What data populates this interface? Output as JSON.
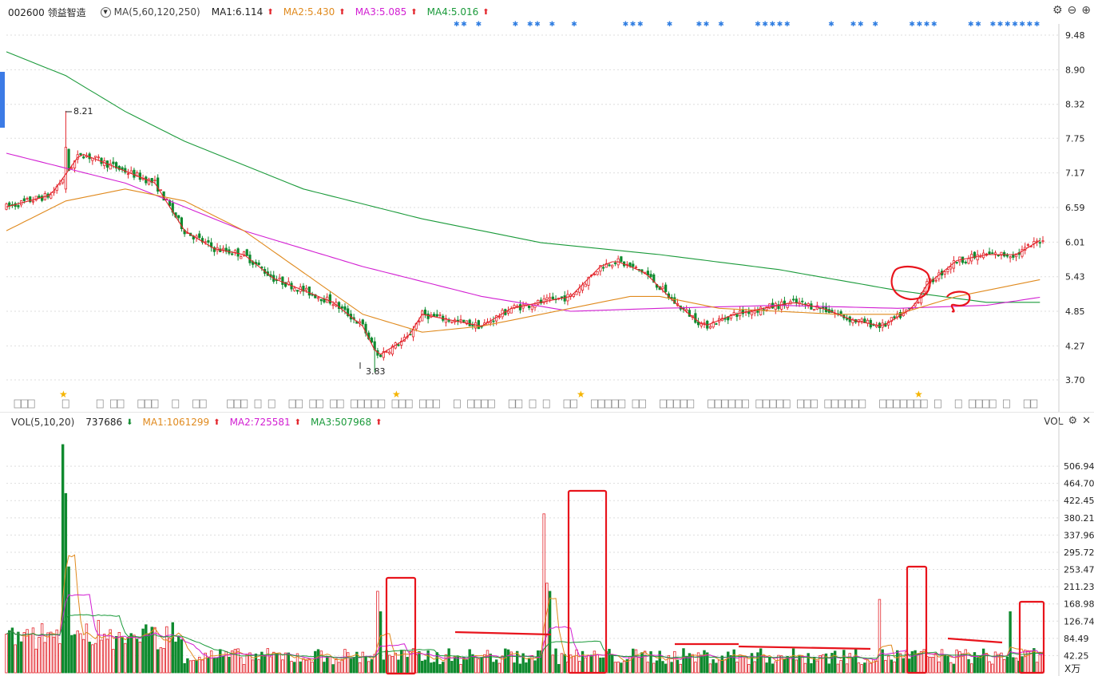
{
  "header": {
    "code_name": "002600 领益智造",
    "ma_setting": "MA(5,60,120,250)",
    "ma1": {
      "label": "MA1:6.114",
      "color": "#222222",
      "dir": "up"
    },
    "ma2": {
      "label": "MA2:5.430",
      "color": "#e08a1e",
      "dir": "up"
    },
    "ma3": {
      "label": "MA3:5.085",
      "color": "#d21ed2",
      "dir": "up"
    },
    "ma4": {
      "label": "MA4:5.016",
      "color": "#1a9a3a",
      "dir": "up"
    }
  },
  "vol_header": {
    "setting": "VOL(5,10,20)",
    "vol": {
      "label": "737686",
      "dir": "down"
    },
    "ma1": {
      "label": "MA1:1061299",
      "color": "#e08a1e",
      "dir": "up"
    },
    "ma2": {
      "label": "MA2:725581",
      "color": "#d21ed2",
      "dir": "up"
    },
    "ma3": {
      "label": "MA3:507968",
      "color": "#1a9a3a",
      "dir": "up"
    },
    "right_label": "VOL"
  },
  "colors": {
    "up": "#e3242b",
    "down": "#0e8a2e",
    "grid": "#dedede",
    "annotation": "#e8141c"
  },
  "chart_data": [
    {
      "type": "candlestick",
      "title": "002600 领益智造",
      "price_ticks": [
        "9.48",
        "8.90",
        "8.32",
        "7.75",
        "7.17",
        "6.59",
        "6.01",
        "5.43",
        "4.85",
        "4.27",
        "3.70"
      ],
      "ylim": [
        3.7,
        9.48
      ],
      "annotations": {
        "high_label": "8.21",
        "low_label": "3.83"
      },
      "ma1_path": [
        [
          0,
          6.6
        ],
        [
          15,
          6.8
        ],
        [
          25,
          7.5
        ],
        [
          30,
          7.4
        ],
        [
          40,
          7.2
        ],
        [
          50,
          7.0
        ],
        [
          60,
          6.2
        ],
        [
          70,
          5.9
        ],
        [
          80,
          5.8
        ],
        [
          90,
          5.4
        ],
        [
          100,
          5.2
        ],
        [
          110,
          5.0
        ],
        [
          120,
          4.6
        ],
        [
          125,
          4.1
        ],
        [
          135,
          4.4
        ],
        [
          140,
          4.8
        ],
        [
          150,
          4.7
        ],
        [
          160,
          4.6
        ],
        [
          170,
          4.9
        ],
        [
          180,
          5.0
        ],
        [
          190,
          5.1
        ],
        [
          200,
          5.6
        ],
        [
          205,
          5.7
        ],
        [
          215,
          5.5
        ],
        [
          225,
          5.0
        ],
        [
          235,
          4.6
        ],
        [
          245,
          4.8
        ],
        [
          255,
          4.9
        ],
        [
          265,
          5.0
        ],
        [
          275,
          4.9
        ],
        [
          285,
          4.7
        ],
        [
          295,
          4.6
        ],
        [
          305,
          4.9
        ],
        [
          310,
          5.3
        ],
        [
          320,
          5.7
        ],
        [
          330,
          5.8
        ],
        [
          340,
          5.8
        ],
        [
          350,
          6.1
        ]
      ],
      "ma2_path": [
        [
          0,
          6.2
        ],
        [
          20,
          6.7
        ],
        [
          40,
          6.9
        ],
        [
          60,
          6.7
        ],
        [
          80,
          6.2
        ],
        [
          100,
          5.5
        ],
        [
          120,
          4.8
        ],
        [
          140,
          4.5
        ],
        [
          160,
          4.6
        ],
        [
          180,
          4.8
        ],
        [
          200,
          5.0
        ],
        [
          210,
          5.1
        ],
        [
          220,
          5.1
        ],
        [
          240,
          4.9
        ],
        [
          260,
          4.85
        ],
        [
          280,
          4.8
        ],
        [
          300,
          4.8
        ],
        [
          320,
          5.1
        ],
        [
          350,
          5.4
        ]
      ],
      "ma3_path": [
        [
          0,
          7.5
        ],
        [
          40,
          7.0
        ],
        [
          80,
          6.2
        ],
        [
          120,
          5.6
        ],
        [
          160,
          5.1
        ],
        [
          190,
          4.85
        ],
        [
          220,
          4.9
        ],
        [
          260,
          4.95
        ],
        [
          300,
          4.9
        ],
        [
          330,
          4.95
        ],
        [
          350,
          5.1
        ]
      ],
      "ma4_path": [
        [
          0,
          9.2
        ],
        [
          20,
          8.8
        ],
        [
          40,
          8.2
        ],
        [
          60,
          7.7
        ],
        [
          80,
          7.3
        ],
        [
          100,
          6.9
        ],
        [
          140,
          6.4
        ],
        [
          180,
          6.0
        ],
        [
          220,
          5.8
        ],
        [
          260,
          5.55
        ],
        [
          300,
          5.2
        ],
        [
          330,
          5.0
        ],
        [
          350,
          5.0
        ]
      ],
      "n_bars": 350
    },
    {
      "type": "bar",
      "title": "VOL(5,10,20)",
      "unit_label": "X万",
      "vol_ticks": [
        "506.94",
        "464.70",
        "422.45",
        "380.21",
        "337.96",
        "295.72",
        "253.47",
        "211.23",
        "168.98",
        "126.74",
        "84.49",
        "42.25"
      ],
      "ylim": [
        0,
        560
      ],
      "spikes": [
        [
          19,
          560
        ],
        [
          20,
          440
        ],
        [
          21,
          260
        ],
        [
          125,
          200
        ],
        [
          126,
          150
        ],
        [
          181,
          390
        ],
        [
          182,
          220
        ],
        [
          183,
          200
        ],
        [
          294,
          180
        ],
        [
          338,
          150
        ]
      ]
    }
  ]
}
